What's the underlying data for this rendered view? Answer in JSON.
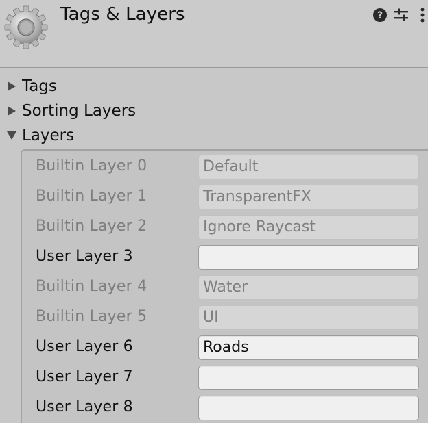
{
  "header": {
    "title": "Tags & Layers",
    "icon": "gear-icon",
    "buttons": [
      "help-icon",
      "presets-icon",
      "menu-icon"
    ]
  },
  "foldouts": [
    {
      "label": "Tags",
      "expanded": false
    },
    {
      "label": "Sorting Layers",
      "expanded": false
    },
    {
      "label": "Layers",
      "expanded": true
    }
  ],
  "layers": [
    {
      "label": "Builtin Layer 0",
      "value": "Default",
      "builtin": true
    },
    {
      "label": "Builtin Layer 1",
      "value": "TransparentFX",
      "builtin": true
    },
    {
      "label": "Builtin Layer 2",
      "value": "Ignore Raycast",
      "builtin": true
    },
    {
      "label": "User Layer 3",
      "value": "",
      "builtin": false
    },
    {
      "label": "Builtin Layer 4",
      "value": "Water",
      "builtin": true
    },
    {
      "label": "Builtin Layer 5",
      "value": "UI",
      "builtin": true
    },
    {
      "label": "User Layer 6",
      "value": "Roads",
      "builtin": false
    },
    {
      "label": "User Layer 7",
      "value": "",
      "builtin": false
    },
    {
      "label": "User Layer 8",
      "value": "",
      "builtin": false
    }
  ],
  "colors": {
    "background": "#c8c8c8",
    "builtin_text": "#7e7e7e",
    "user_text": "#111111",
    "field_editable": "#f0f0f0",
    "field_disabled": "#d6d6d6"
  }
}
